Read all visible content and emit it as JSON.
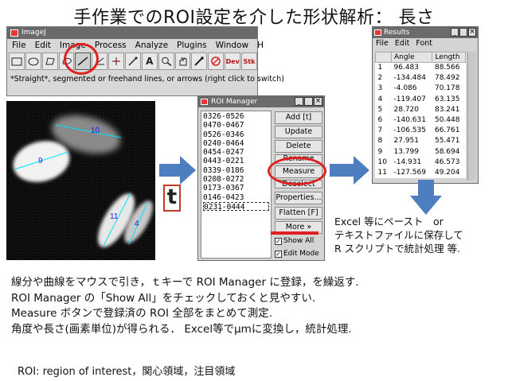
{
  "title": "手作業でのROI設定を介した形状解析： 長さ",
  "imagej": {
    "window_title": "ImageJ",
    "menu": [
      "File",
      "Edit",
      "Image",
      "Process",
      "Analyze",
      "Plugins",
      "Window",
      "H"
    ],
    "status": "*Straight*, segmented or freehand lines, or arrows (right click to switch)",
    "tools": [
      {
        "icon": "rectangle-tool"
      },
      {
        "icon": "oval-tool"
      },
      {
        "icon": "polygon-tool"
      },
      {
        "icon": "freehand-tool"
      },
      {
        "icon": "line-tool",
        "selected": true
      },
      {
        "icon": "angle-tool"
      },
      {
        "icon": "point-tool"
      },
      {
        "icon": "wand-tool"
      },
      {
        "icon": "text-tool"
      },
      {
        "icon": "magnifier-tool"
      },
      {
        "icon": "hand-tool"
      },
      {
        "icon": "dropper-tool"
      },
      {
        "icon": "color-picker-tool"
      }
    ],
    "tool_text_dev": "Dev",
    "tool_text_stk": "Stk"
  },
  "roi_manager": {
    "window_title": "ROI Manager",
    "items": [
      "0326-0526",
      "0470-0467",
      "0526-0346",
      "0240-0464",
      "0454-0247",
      "0443-0221",
      "0339-0186",
      "0208-0272",
      "0173-0367",
      "0146-0423",
      "0231-0444"
    ],
    "buttons": [
      "Add [t]",
      "Update",
      "Delete",
      "Rename",
      "Measure",
      "Deselect",
      "Properties...",
      "Flatten [F]",
      "More »"
    ],
    "show_all": "Show All",
    "edit_mode": "Edit Mode"
  },
  "results": {
    "window_title": "Results",
    "menu": [
      "File",
      "Edit",
      "Font"
    ],
    "columns": [
      "",
      "Angle",
      "Length"
    ],
    "rows": [
      [
        "1",
        "96.483",
        "88.566"
      ],
      [
        "2",
        "-134.484",
        "78.492"
      ],
      [
        "3",
        "-4.086",
        "70.178"
      ],
      [
        "4",
        "-119.407",
        "63.135"
      ],
      [
        "5",
        "28.720",
        "83.241"
      ],
      [
        "6",
        "-140.631",
        "50.448"
      ],
      [
        "7",
        "-106.535",
        "66.761"
      ],
      [
        "8",
        "27.951",
        "55.471"
      ],
      [
        "9",
        "13.799",
        "58.694"
      ],
      [
        "10",
        "-14.931",
        "46.573"
      ],
      [
        "11",
        "-127.569",
        "49.204"
      ]
    ]
  },
  "micro_labels": [
    "10",
    "9",
    "11",
    "4"
  ],
  "t_key": "t",
  "excel_note": [
    "Excel 等にペースト　or",
    "テキストファイルに保存して",
    "R スクリプトで統計処理 等."
  ],
  "description": [
    "線分や曲線をマウスで引き，ｔキーで ROI Manager に登録，を繰返す.",
    "ROI Manager の「Show All」をチェックしておくと見やすい.",
    "Measure ボタンで登録済の ROI 全部をまとめて測定.",
    "角度や長さ(画素単位)が得られる． Excel等でμmに変換し，統計処理."
  ],
  "footnote": "ROI: region of interest，関心領域，注目領域",
  "colors": {
    "highlight": "#e02020",
    "arrow": "#4d7ec0",
    "roi_line": "#00e5ff"
  }
}
